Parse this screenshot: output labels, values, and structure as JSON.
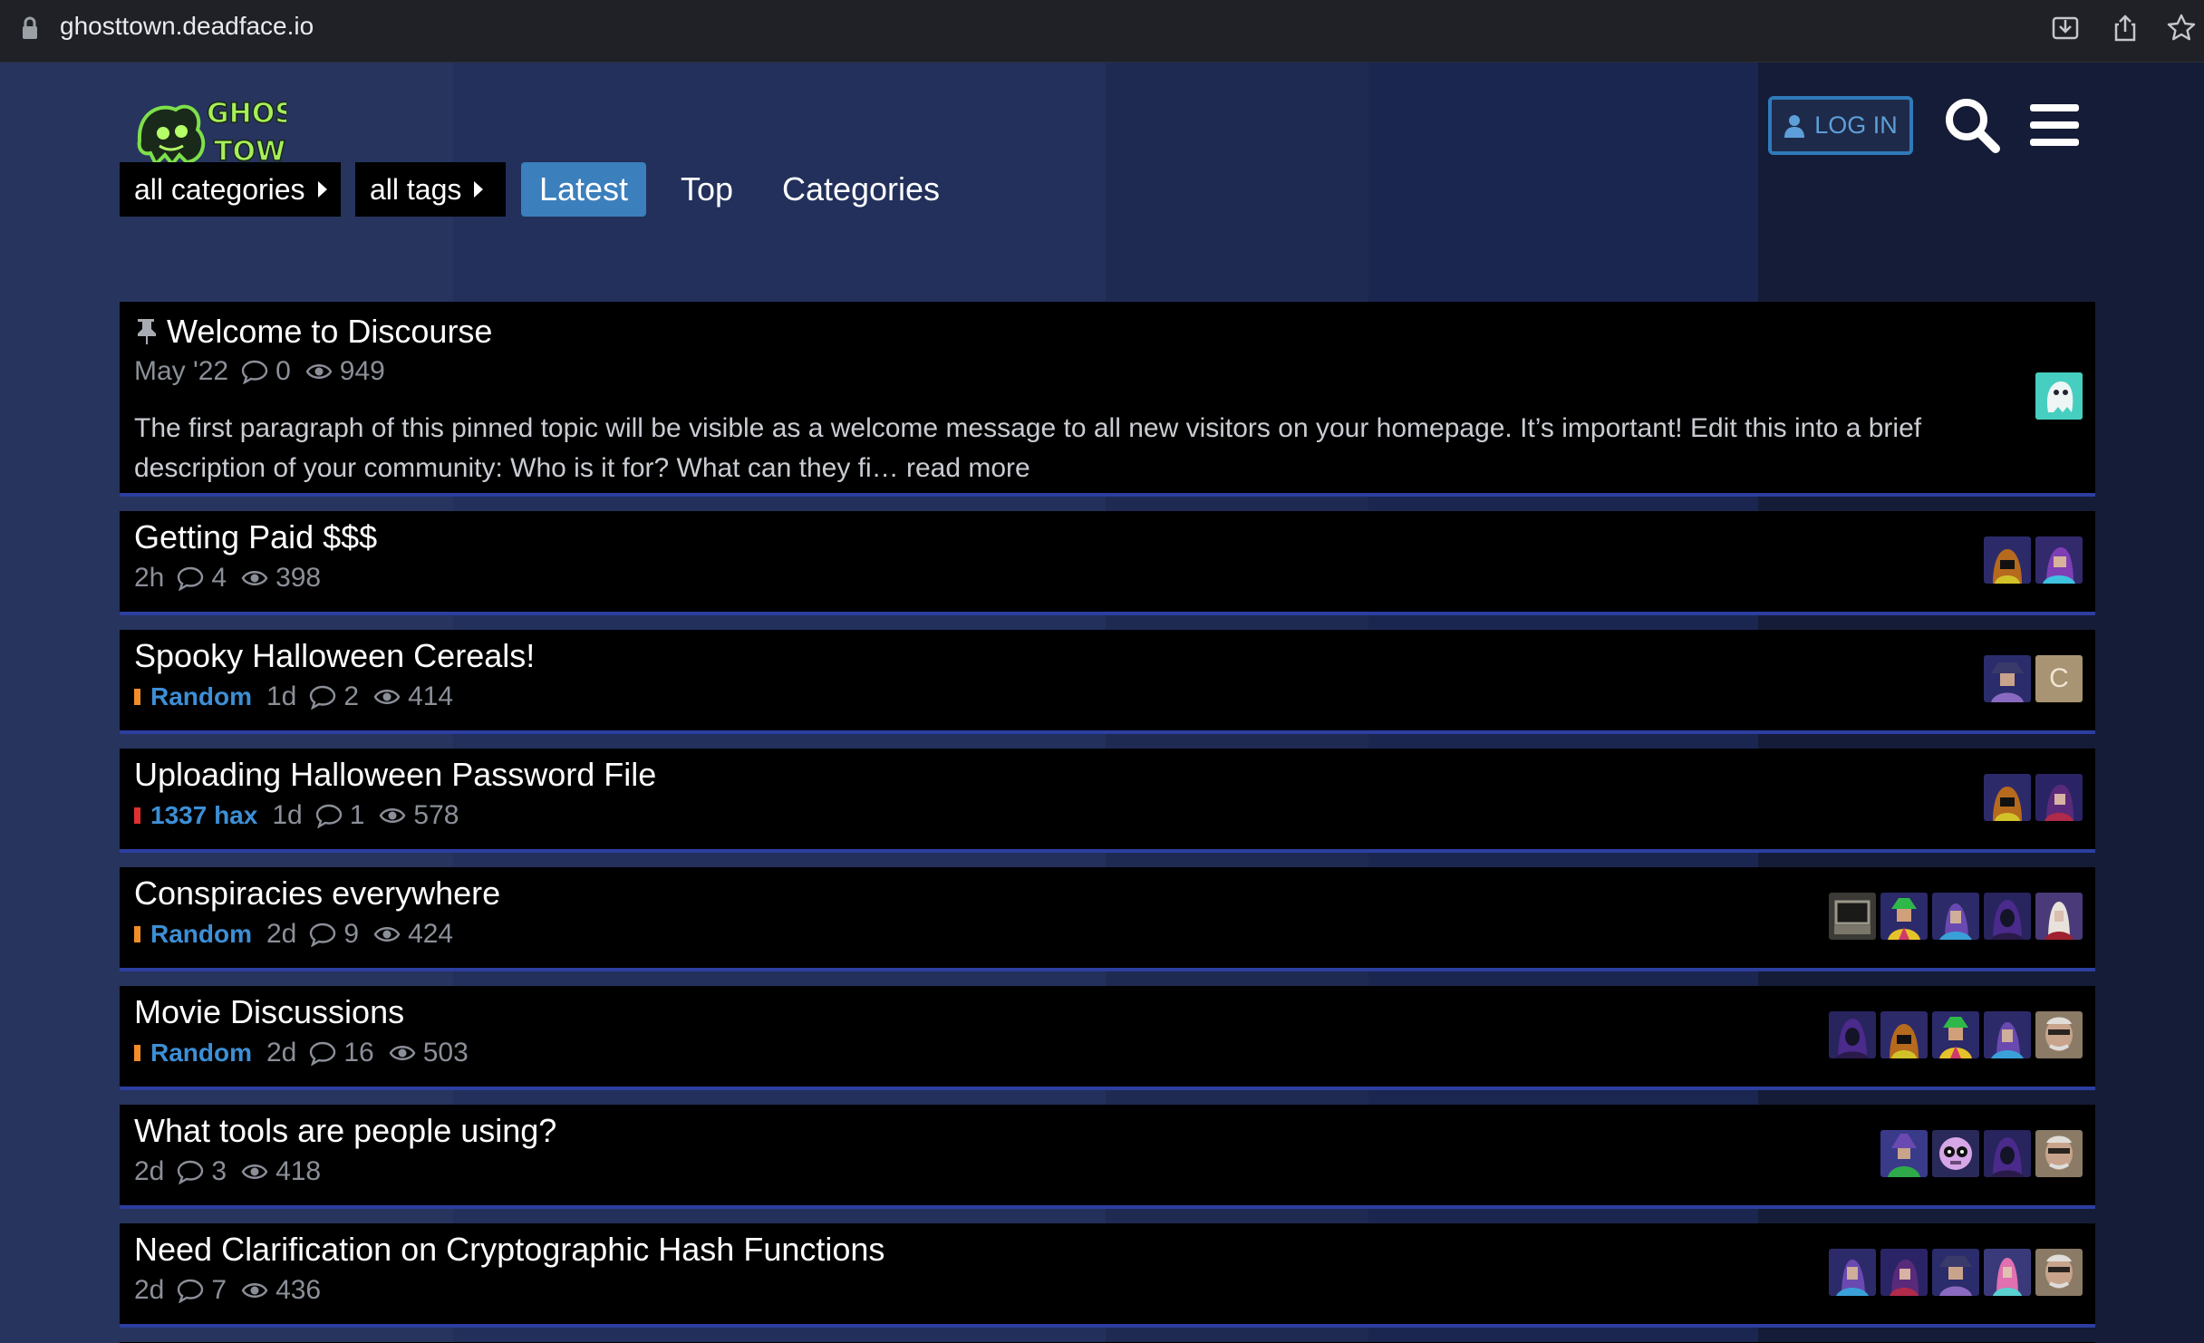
{
  "browser": {
    "url": "ghosttown.deadface.io"
  },
  "header": {
    "login_label": "LOG IN"
  },
  "nav": {
    "category_filter": "all categories",
    "tag_filter": "all tags",
    "tabs": [
      "Latest",
      "Top",
      "Categories"
    ],
    "active_tab": "Latest"
  },
  "topics": [
    {
      "title": "Welcome to Discourse",
      "pinned": true,
      "category": null,
      "age": "May '22",
      "replies": "0",
      "views": "949",
      "excerpt": "The first paragraph of this pinned topic will be visible as a welcome message to all new visitors on your homepage. It’s important! Edit this into a brief description of your community: Who is it for? What can they fi… read more",
      "posters": [
        "ghost-avatar"
      ]
    },
    {
      "title": "Getting Paid $$$",
      "category": null,
      "age": "2h",
      "replies": "4",
      "views": "398",
      "posters": [
        "hacker-avatar-orange",
        "hacker-avatar-purple"
      ]
    },
    {
      "title": "Spooky Halloween Cereals!",
      "category": "Random",
      "category_color": "#f28c28",
      "age": "1d",
      "replies": "2",
      "views": "414",
      "posters": [
        "hacker-avatar-hat",
        "letter-avatar-c"
      ],
      "letter_avatar": "C"
    },
    {
      "title": "Uploading Halloween Password File",
      "category": "1337 hax",
      "category_color": "#e02f2f",
      "age": "1d",
      "replies": "1",
      "views": "578",
      "posters": [
        "hacker-avatar-orange",
        "hacker-avatar-red"
      ]
    },
    {
      "title": "Conspiracies everywhere",
      "category": "Random",
      "category_color": "#f28c28",
      "age": "2d",
      "replies": "9",
      "views": "424",
      "posters": [
        "computer-avatar",
        "hacker-avatar-yellow",
        "hacker-avatar-blue",
        "hacker-avatar-hood",
        "hacker-avatar-pale"
      ]
    },
    {
      "title": "Movie Discussions",
      "category": "Random",
      "category_color": "#f28c28",
      "age": "2d",
      "replies": "16",
      "views": "503",
      "posters": [
        "hacker-avatar-hood",
        "hacker-avatar-orange",
        "hacker-avatar-yellow",
        "hacker-avatar-blue",
        "photo-avatar-man"
      ]
    },
    {
      "title": "What tools are people using?",
      "category": null,
      "age": "2d",
      "replies": "3",
      "views": "418",
      "posters": [
        "hacker-avatar-green",
        "skull-avatar",
        "hacker-avatar-hood",
        "photo-avatar-man"
      ]
    },
    {
      "title": "Need Clarification on Cryptographic Hash Functions",
      "category": null,
      "age": "2d",
      "replies": "7",
      "views": "436",
      "posters": [
        "hacker-avatar-blue",
        "hacker-avatar-red",
        "hacker-avatar-hat",
        "hacker-avatar-pink",
        "photo-avatar-man"
      ]
    }
  ]
}
